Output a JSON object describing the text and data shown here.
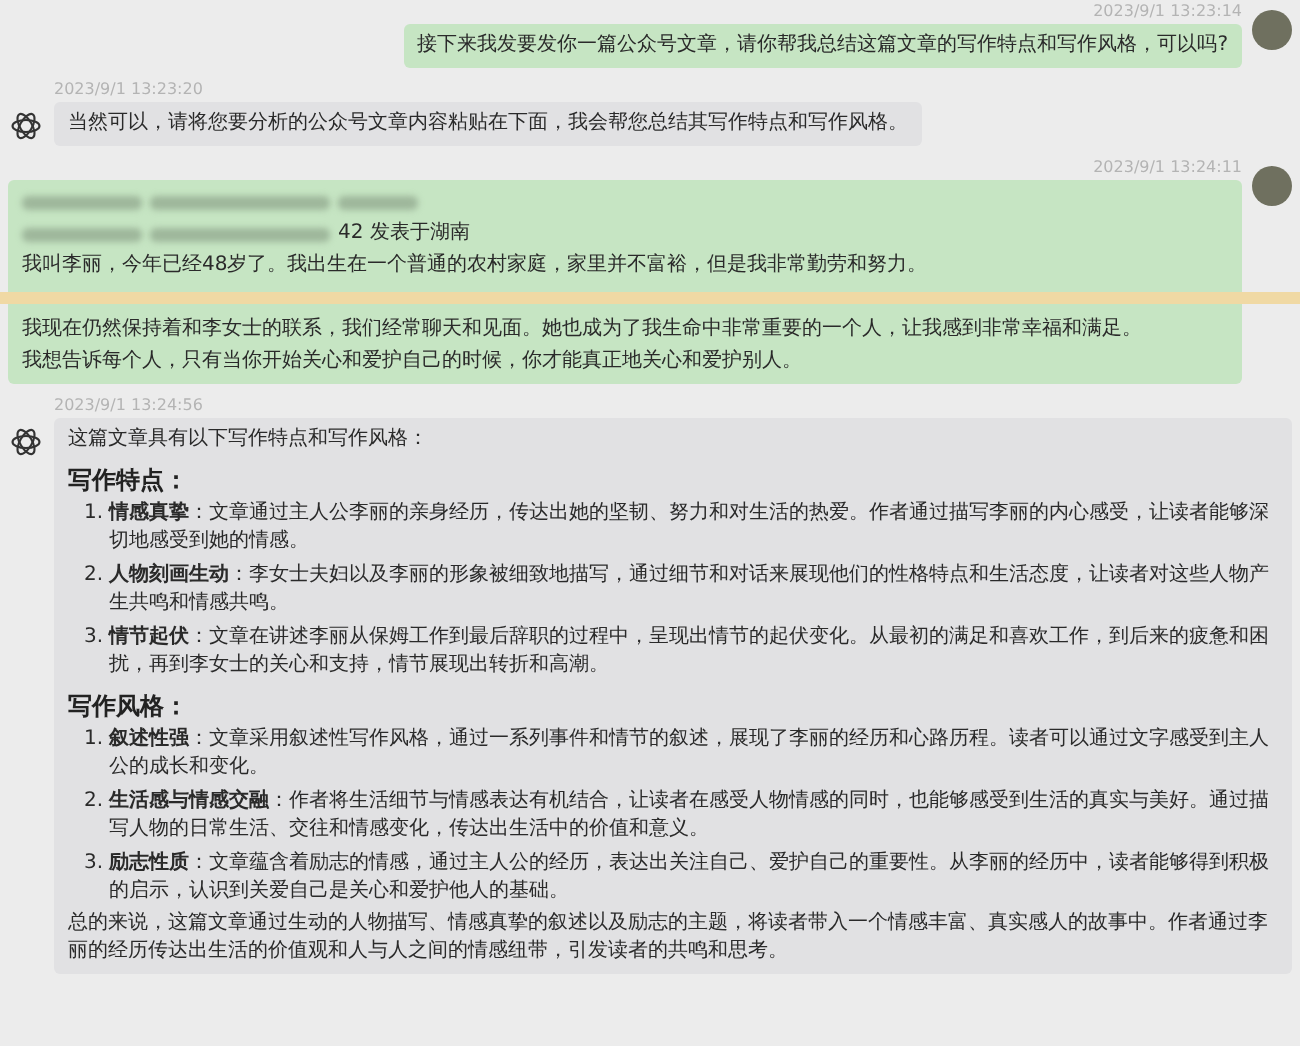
{
  "messages": [
    {
      "kind": "user",
      "timestamp": "2023/9/1 13:23:14",
      "parts": [
        {
          "kind": "text",
          "text": "接下来我发要发你一篇公众号文章，请你帮我总结这篇文章的写作特点和写作风格，可以吗?"
        }
      ]
    },
    {
      "kind": "assistant",
      "timestamp": "2023/9/1 13:23:20",
      "parts": [
        {
          "kind": "text",
          "text": "当然可以，请将您要分析的公众号文章内容粘贴在下面，我会帮您总结其写作特点和写作风格。"
        }
      ]
    },
    {
      "kind": "user",
      "timestamp": "2023/9/1 13:24:11",
      "parts": [
        {
          "kind": "redacted"
        },
        {
          "kind": "redacted",
          "text": "42 发表于湖南"
        },
        {
          "kind": "text",
          "text": "我叫李丽，今年已经48岁了。我出生在一个普通的农村家庭，家里并不富裕，但是我非常勤劳和努力。"
        },
        {
          "kind": "fold"
        },
        {
          "kind": "text",
          "text": "我现在仍然保持着和李女士的联系，我们经常聊天和见面。她也成为了我生命中非常重要的一个人，让我感到非常幸福和满足。"
        },
        {
          "kind": "text",
          "text": "我想告诉每个人，只有当你开始关心和爱护自己的时候，你才能真正地关心和爱护别人。"
        }
      ]
    },
    {
      "kind": "assistant",
      "timestamp": "2023/9/1 13:24:56",
      "parts": [
        {
          "kind": "text",
          "text": "这篇文章具有以下写作特点和写作风格："
        },
        {
          "kind": "heading",
          "text": "写作特点："
        },
        {
          "kind": "list",
          "items": [
            {
              "number": "1.",
              "label": "情感真挚",
              "text": "：文章通过主人公李丽的亲身经历，传达出她的坚韧、努力和对生活的热爱。作者通过描写李丽的内心感受，让读者能够深切地感受到她的情感。"
            },
            {
              "number": "2.",
              "label": "人物刻画生动",
              "text": "：李女士夫妇以及李丽的形象被细致地描写，通过细节和对话来展现他们的性格特点和生活态度，让读者对这些人物产生共鸣和情感共鸣。"
            },
            {
              "number": "3.",
              "label": "情节起伏",
              "text": "：文章在讲述李丽从保姆工作到最后辞职的过程中，呈现出情节的起伏变化。从最初的满足和喜欢工作，到后来的疲惫和困扰，再到李女士的关心和支持，情节展现出转折和高潮。"
            }
          ]
        },
        {
          "kind": "heading",
          "text": "写作风格："
        },
        {
          "kind": "list",
          "items": [
            {
              "number": "1.",
              "label": "叙述性强",
              "text": "：文章采用叙述性写作风格，通过一系列事件和情节的叙述，展现了李丽的经历和心路历程。读者可以通过文字感受到主人公的成长和变化。"
            },
            {
              "number": "2.",
              "label": "生活感与情感交融",
              "text": "：作者将生活细节与情感表达有机结合，让读者在感受人物情感的同时，也能够感受到生活的真实与美好。通过描写人物的日常生活、交往和情感变化，传达出生活中的价值和意义。"
            },
            {
              "number": "3.",
              "label": "励志性质",
              "text": "：文章蕴含着励志的情感，通过主人公的经历，表达出关注自己、爱护自己的重要性。从李丽的经历中，读者能够得到积极的启示，认识到关爱自己是关心和爱护他人的基础。"
            }
          ]
        },
        {
          "kind": "text",
          "text": "总的来说，这篇文章通过生动的人物描写、情感真挚的叙述以及励志的主题，将读者带入一个情感丰富、真实感人的故事中。作者通过李丽的经历传达出生活的价值观和人与人之间的情感纽带，引发读者的共鸣和思考。"
        }
      ]
    }
  ]
}
